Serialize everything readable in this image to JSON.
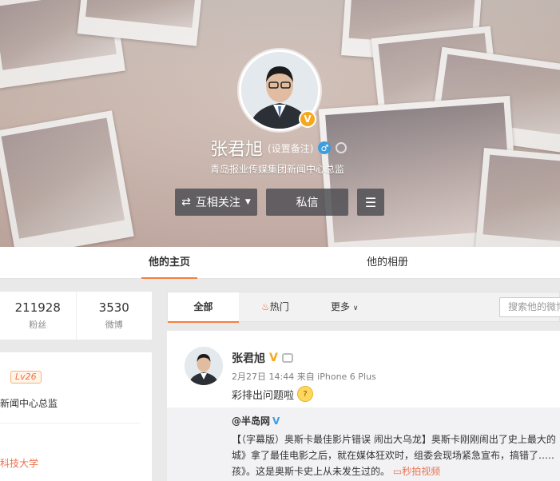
{
  "profile": {
    "name": "张君旭",
    "remark": "(设置备注)",
    "gender_icon": "♂",
    "verify_badge": "V",
    "bio": "青岛报业传媒集团新闻中心总监",
    "buttons": {
      "follow": "互相关注",
      "message": "私信"
    }
  },
  "tabs": {
    "home": "他的主页",
    "album": "他的相册"
  },
  "stats": [
    {
      "value": "211928",
      "label": "粉丝"
    },
    {
      "value": "3530",
      "label": "微博"
    }
  ],
  "info": {
    "level": "Lv26",
    "job": "新闻中心总监",
    "school": "科技大学"
  },
  "feed": {
    "tabs": {
      "all": "全部",
      "hot": "热门",
      "more": "更多"
    },
    "search_placeholder": "搜索他的微博"
  },
  "post": {
    "author": "张君旭",
    "verify": "V",
    "meta": "2月27日 14:44 来自 iPhone 6 Plus",
    "text": "彩排出问题啦",
    "repost": {
      "user": "@半岛网",
      "verify": "V",
      "line1": "【（字幕版）奥斯卡最佳影片错误 闹出大乌龙】奥斯卡刚刚闹出了史上最大的",
      "line2": "城》拿了最佳电影之后，就在媒体狂欢时，组委会现场紧急宣布，搞错了……是",
      "line3": "孩》。这是奥斯卡史上从未发生过的。",
      "video_link": "秒拍视频"
    }
  },
  "colors": {
    "accent": "#fa7d3c",
    "verify_orange": "#f6a71c",
    "link_orange": "#eb7350"
  }
}
